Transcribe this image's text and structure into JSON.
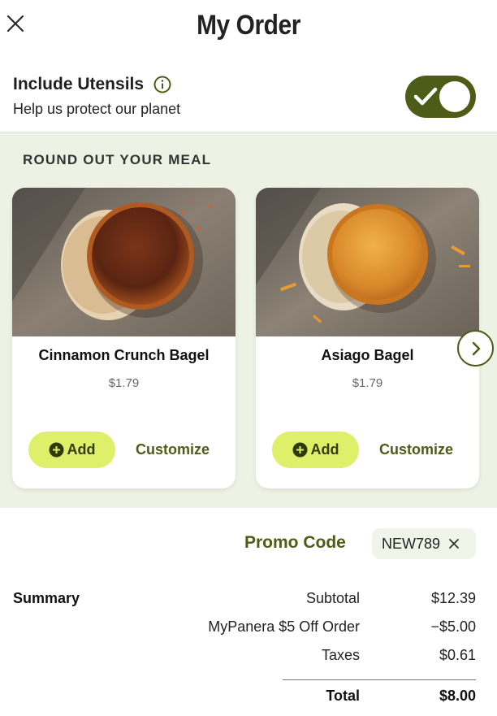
{
  "header": {
    "title": "My Order"
  },
  "utensils": {
    "title": "Include Utensils",
    "subtitle": "Help us protect our planet",
    "enabled": true
  },
  "upsell": {
    "title": "ROUND OUT YOUR MEAL",
    "items": [
      {
        "name": "Cinnamon Crunch Bagel",
        "price": "$1.79",
        "add_label": "Add",
        "customize_label": "Customize"
      },
      {
        "name": "Asiago Bagel",
        "price": "$1.79",
        "add_label": "Add",
        "customize_label": "Customize"
      }
    ]
  },
  "promo": {
    "label": "Promo Code",
    "code": "NEW789"
  },
  "summary": {
    "label": "Summary",
    "rows": [
      {
        "label": "Subtotal",
        "value": "$12.39"
      },
      {
        "label": "MyPanera $5 Off Order",
        "value": "−$5.00"
      },
      {
        "label": "Taxes",
        "value": "$0.61"
      }
    ],
    "total": {
      "label": "Total",
      "value": "$8.00"
    }
  },
  "colors": {
    "brand_green": "#4d5c16",
    "accent_lime": "#def06a",
    "section_bg": "#eef2e4"
  },
  "icons": [
    "close-icon",
    "info-icon",
    "check-icon",
    "plus-circle-icon",
    "chevron-right-icon",
    "remove-x-icon"
  ]
}
